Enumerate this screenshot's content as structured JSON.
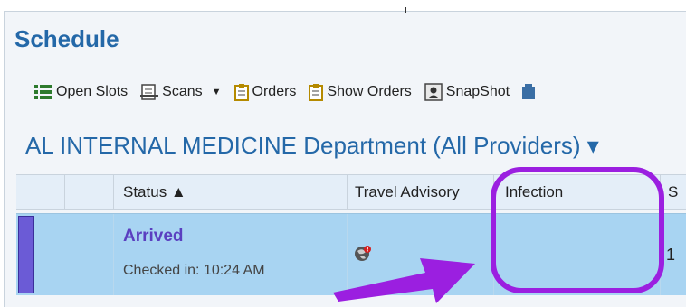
{
  "title": "Schedule",
  "toolbar": {
    "open_slots": "Open Slots",
    "scans": "Scans",
    "orders": "Orders",
    "show_orders": "Show Orders",
    "snapshot": "SnapShot"
  },
  "department": "AL INTERNAL MEDICINE Department (All Providers) ▾",
  "grid": {
    "headers": {
      "status": "Status ▲",
      "travel_advisory": "Travel Advisory",
      "infection": "Infection",
      "next": "S"
    },
    "row": {
      "status": "Arrived",
      "checked_in": "Checked in: 10:24 AM",
      "next_col": "1"
    }
  },
  "icons": {
    "travel_advisory": "globe-alert-icon"
  },
  "colors": {
    "title": "#2468a8",
    "selected_row": "#a8d4f2",
    "status_text": "#5a3fc0",
    "callout": "#9b1fe0"
  }
}
